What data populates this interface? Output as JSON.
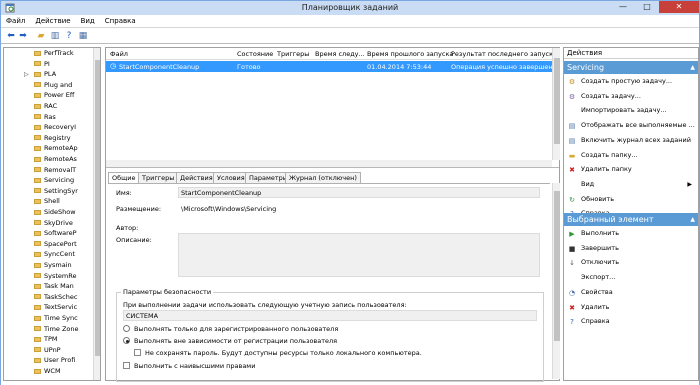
{
  "window": {
    "title": "Планировщик заданий",
    "minimize": "—",
    "maximize": "□",
    "close": "✕"
  },
  "menu": [
    "Файл",
    "Действие",
    "Вид",
    "Справка"
  ],
  "toolbar_icons": [
    "back-arrow-icon",
    "forward-arrow-icon",
    "up-folder-icon",
    "console-tree-icon",
    "help-icon",
    "properties-icon"
  ],
  "tree": {
    "items": [
      {
        "label": "PerfTrack",
        "expandable": false
      },
      {
        "label": "PI",
        "expandable": false
      },
      {
        "label": "PLA",
        "expandable": true
      },
      {
        "label": "Plug and",
        "expandable": false
      },
      {
        "label": "Power Eff",
        "expandable": false
      },
      {
        "label": "RAC",
        "expandable": false
      },
      {
        "label": "Ras",
        "expandable": false
      },
      {
        "label": "RecoveryI",
        "expandable": false
      },
      {
        "label": "Registry",
        "expandable": false
      },
      {
        "label": "RemoteAp",
        "expandable": false
      },
      {
        "label": "RemoteAs",
        "expandable": false
      },
      {
        "label": "RemovalT",
        "expandable": false
      },
      {
        "label": "Servicing",
        "expandable": false
      },
      {
        "label": "SettingSyr",
        "expandable": false
      },
      {
        "label": "Shell",
        "expandable": false
      },
      {
        "label": "SideShow",
        "expandable": false
      },
      {
        "label": "SkyDrive",
        "expandable": false
      },
      {
        "label": "SoftwareP",
        "expandable": false
      },
      {
        "label": "SpacePort",
        "expandable": false
      },
      {
        "label": "SyncCent",
        "expandable": false
      },
      {
        "label": "Sysmain",
        "expandable": false
      },
      {
        "label": "SystemRe",
        "expandable": false
      },
      {
        "label": "Task Man",
        "expandable": false
      },
      {
        "label": "TaskSchec",
        "expandable": false
      },
      {
        "label": "TextServic",
        "expandable": false
      },
      {
        "label": "Time Sync",
        "expandable": false
      },
      {
        "label": "Time Zone",
        "expandable": false
      },
      {
        "label": "TPM",
        "expandable": false
      },
      {
        "label": "UPnP",
        "expandable": false
      },
      {
        "label": "User Profi",
        "expandable": false
      },
      {
        "label": "WCM",
        "expandable": false
      }
    ]
  },
  "task_list": {
    "columns": [
      "Файл",
      "Состояние",
      "Триггеры",
      "Время следу...",
      "Время прошлого запуска",
      "Результат последнего запуска"
    ],
    "rows": [
      {
        "name": "StartComponentCleanup",
        "status": "Готово",
        "triggers": "",
        "next_run": "",
        "last_run": "01.04.2014 7:53:44",
        "last_result": "Операция успешно завершена. (0x0)"
      }
    ]
  },
  "tabs": [
    "Общие",
    "Триггеры",
    "Действия",
    "Условия",
    "Параметры",
    "Журнал (отключен)"
  ],
  "general": {
    "name_label": "Имя:",
    "name_value": "StartComponentCleanup",
    "location_label": "Размещение:",
    "location_value": "\\Microsoft\\Windows\\Servicing",
    "author_label": "Автор:",
    "description_label": "Описание:",
    "security": {
      "title": "Параметры безопасности",
      "account_prompt": "При выполнении задачи использовать следующую учетную запись пользователя:",
      "account_value": "СИСТЕМА",
      "option_logged_on": "Выполнять только для зарегистрированного пользователя",
      "option_any": "Выполнять вне зависимости от регистрации пользователя",
      "no_store_password": "Не сохранять пароль. Будут доступны ресурсы только локального компьютера.",
      "highest_privileges": "Выполнить с наивысшими правами"
    }
  },
  "actions_pane": {
    "header": "Действия",
    "section1_title": "Servicing",
    "section1_items": [
      {
        "label": "Создать простую задачу...",
        "icon": "create-basic-task-icon",
        "glyph": "⚙",
        "color": "#c58a1a",
        "submenu": false
      },
      {
        "label": "Создать задачу...",
        "icon": "create-task-icon",
        "glyph": "⚙",
        "color": "#7a5fa6",
        "submenu": false
      },
      {
        "label": "Импортировать задачу...",
        "icon": "",
        "glyph": "",
        "color": "#000000",
        "submenu": false
      },
      {
        "label": "Отображать все выполняемые ...",
        "icon": "running-tasks-icon",
        "glyph": "▤",
        "color": "#4a6fa5",
        "submenu": false
      },
      {
        "label": "Включить журнал всех заданий",
        "icon": "history-icon",
        "glyph": "▤",
        "color": "#4a6fa5",
        "submenu": false
      },
      {
        "label": "Создать папку...",
        "icon": "new-folder-icon",
        "glyph": "▬",
        "color": "#d9a734",
        "submenu": false
      },
      {
        "label": "Удалить папку",
        "icon": "delete-icon",
        "glyph": "✖",
        "color": "#cc2222",
        "submenu": false
      },
      {
        "label": "Вид",
        "icon": "",
        "glyph": "",
        "color": "#000000",
        "submenu": true
      },
      {
        "label": "Обновить",
        "icon": "refresh-icon",
        "glyph": "↻",
        "color": "#2a8a3a",
        "submenu": false
      },
      {
        "label": "Справка",
        "icon": "help-icon",
        "glyph": "?",
        "color": "#1f5fbf",
        "submenu": false
      }
    ],
    "section2_title": "Выбранный элемент",
    "section2_items": [
      {
        "label": "Выполнить",
        "icon": "run-icon",
        "glyph": "▶",
        "color": "#2a9a3a",
        "submenu": false
      },
      {
        "label": "Завершить",
        "icon": "end-icon",
        "glyph": "■",
        "color": "#333333",
        "submenu": false
      },
      {
        "label": "Отключить",
        "icon": "disable-icon",
        "glyph": "↓",
        "color": "#555555",
        "submenu": false
      },
      {
        "label": "Экспорт...",
        "icon": "",
        "glyph": "",
        "color": "#000000",
        "submenu": false
      },
      {
        "label": "Свойства",
        "icon": "properties-icon",
        "glyph": "◔",
        "color": "#4a6fa5",
        "submenu": false
      },
      {
        "label": "Удалить",
        "icon": "delete-icon",
        "glyph": "✖",
        "color": "#cc2222",
        "submenu": false
      },
      {
        "label": "Справка",
        "icon": "help-icon",
        "glyph": "?",
        "color": "#1f5fbf",
        "submenu": false
      }
    ]
  }
}
